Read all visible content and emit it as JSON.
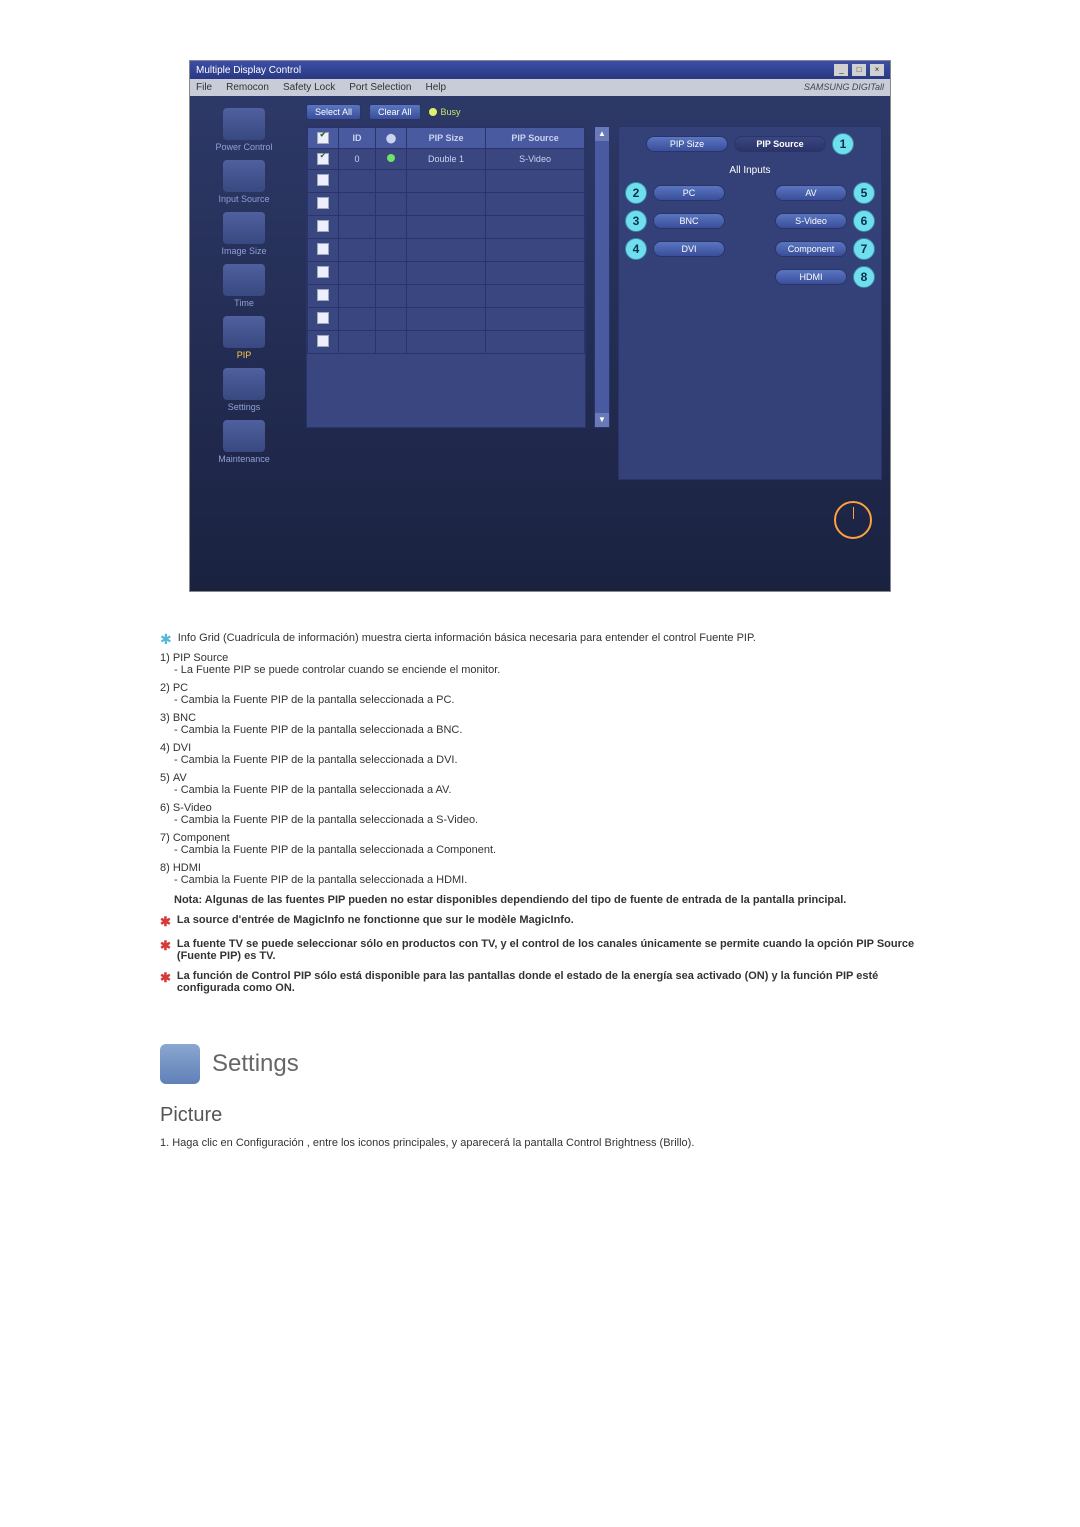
{
  "window": {
    "title": "Multiple Display Control",
    "menu": {
      "file": "File",
      "remocon": "Remocon",
      "safety": "Safety Lock",
      "port": "Port Selection",
      "help": "Help"
    },
    "brand": "SAMSUNG DIGITall"
  },
  "sidebar": {
    "power": "Power Control",
    "input": "Input Source",
    "image": "Image Size",
    "time": "Time",
    "pip": "PIP",
    "settings": "Settings",
    "maint": "Maintenance"
  },
  "buttons": {
    "selectall": "Select All",
    "clearall": "Clear All",
    "busy": "Busy"
  },
  "grid": {
    "headers": {
      "id": "ID",
      "pipsize": "PIP Size",
      "pipsource": "PIP Source"
    },
    "row": {
      "id": "0",
      "pipsize": "Double 1",
      "pipsource": "S-Video"
    }
  },
  "right": {
    "pipsize": "PIP Size",
    "pipsource": "PIP Source",
    "allinputs": "All Inputs",
    "pc": "PC",
    "av": "AV",
    "bnc": "BNC",
    "svideo": "S-Video",
    "dvi": "DVI",
    "component": "Component",
    "hdmi": "HDMI"
  },
  "doc": {
    "star_intro": "Info Grid (Cuadrícula de información) muestra cierta información básica necesaria para entender el control Fuente PIP.",
    "i1t": "PIP Source",
    "i1s": "- La Fuente PIP se puede controlar cuando se enciende el monitor.",
    "i2t": "PC",
    "i2s": "- Cambia la Fuente PIP de la pantalla seleccionada a PC.",
    "i3t": "BNC",
    "i3s": "- Cambia la Fuente PIP de la pantalla seleccionada a BNC.",
    "i4t": "DVI",
    "i4s": "- Cambia la Fuente PIP de la pantalla seleccionada a DVI.",
    "i5t": "AV",
    "i5s": "- Cambia la Fuente PIP de la pantalla seleccionada a AV.",
    "i6t": "S-Video",
    "i6s": "- Cambia la Fuente PIP de la pantalla seleccionada a S-Video.",
    "i7t": "Component",
    "i7s": "- Cambia la Fuente PIP de la pantalla seleccionada a Component.",
    "i8t": "HDMI",
    "i8s": "- Cambia la Fuente PIP de la pantalla seleccionada a HDMI.",
    "note": "Nota: Algunas de las fuentes PIP pueden no estar disponibles dependiendo del tipo de fuente de entrada de la pantalla principal.",
    "b1": "La source d'entrée de MagicInfo ne fonctionne que sur le modèle MagicInfo.",
    "b2": "La fuente TV se puede seleccionar sólo en productos con TV, y el control de los canales únicamente se permite cuando la opción PIP Source (Fuente PIP) es TV.",
    "b3": "La función de Control PIP sólo está disponible para las pantallas donde el estado de la energía sea activado (ON) y la función PIP esté configurada como ON.",
    "settings_h": "Settings",
    "picture_h": "Picture",
    "picture_1": "1.  Haga clic en Configuración , entre los iconos principales, y aparecerá la pantalla Control Brightness (Brillo)."
  },
  "nums": {
    "n1": "1)",
    "n2": "2)",
    "n3": "3)",
    "n4": "4)",
    "n5": "5)",
    "n6": "6)",
    "n7": "7)",
    "n8": "8)",
    "c1": "1",
    "c2": "2",
    "c3": "3",
    "c4": "4",
    "c5": "5",
    "c6": "6",
    "c7": "7",
    "c8": "8"
  }
}
